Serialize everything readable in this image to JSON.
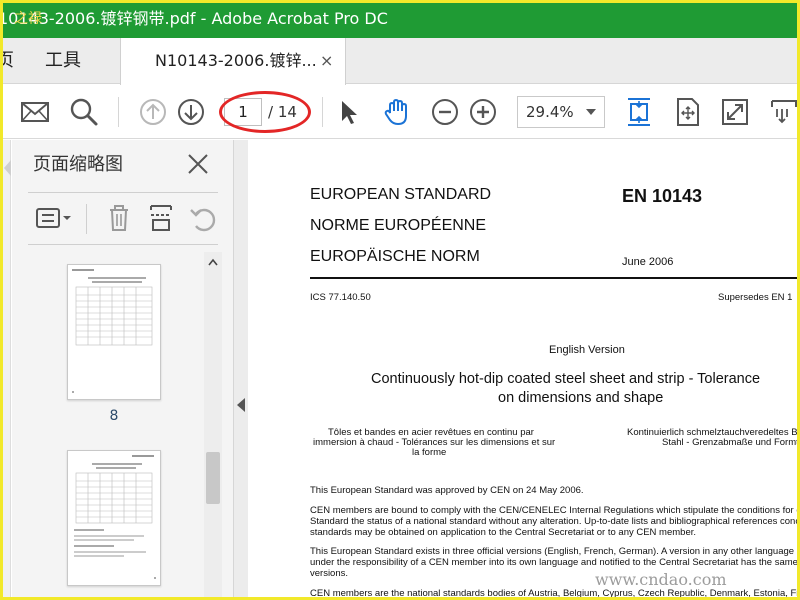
{
  "window": {
    "title": "10143-2006.镀锌钢带.pdf - Adobe Acrobat Pro DC"
  },
  "menubar": {
    "home_label": "页",
    "tools_label": "工具",
    "document_tab": "N10143-2006.镀锌...",
    "tab_close": "×"
  },
  "toolbar": {
    "icons": [
      "mail-icon",
      "search-icon",
      "prev-page-icon",
      "next-page-icon",
      "select-arrow-icon",
      "hand-icon",
      "zoom-out-icon",
      "zoom-in-icon",
      "fit-page-icon",
      "rotate-page-icon",
      "fullscreen-icon",
      "more-tools-icon"
    ],
    "page_current": "1",
    "page_total": "/ 14",
    "zoom_value": "29.4%"
  },
  "sidebar": {
    "title": "页面缩略图",
    "tools": [
      "thumbnail-options-icon",
      "delete-page-icon",
      "insert-page-icon",
      "undo-icon"
    ],
    "thumbnails": [
      {
        "label": "8"
      },
      {
        "label": ""
      }
    ]
  },
  "document": {
    "lines": [
      "EUROPEAN STANDARD",
      "NORME EUROPÉENNE",
      "EUROPÄISCHE NORM",
      "EN 10143",
      "June 2006",
      "ICS 77.140.50",
      "Supersedes EN 1",
      "English Version",
      "Continuously hot-dip coated steel sheet and strip - Tolerance",
      "on dimensions and shape",
      "Tôles et bandes en acier revêtues en continu par",
      "immersion à chaud - Tolérances sur les dimensions et sur",
      "la forme",
      "Kontinuierlich schmelztauchveredeltes Ble",
      "Stahl - Grenzabmaße und Formto",
      "This European Standard was approved by CEN on 24 May 2006.",
      "CEN members are bound to comply with the CEN/CENELEC Internal Regulations which stipulate the conditions for giving",
      "Standard the status of a national standard without any alteration. Up-to-date lists and bibliographical references concerning",
      "standards may be obtained on application to the Central Secretariat or to any CEN member.",
      "This European Standard exists in three official versions (English, French, German). A version in any other language made",
      "under the responsibility of a CEN member into its own language and notified to the Central Secretariat has the same statu",
      "versions.",
      "CEN members are the national standards bodies of Austria, Belgium, Cyprus, Czech Republic, Denmark, Estonia, Finland"
    ]
  },
  "watermark": {
    "text": "www.cndao.com",
    "top_text": "之禄"
  }
}
